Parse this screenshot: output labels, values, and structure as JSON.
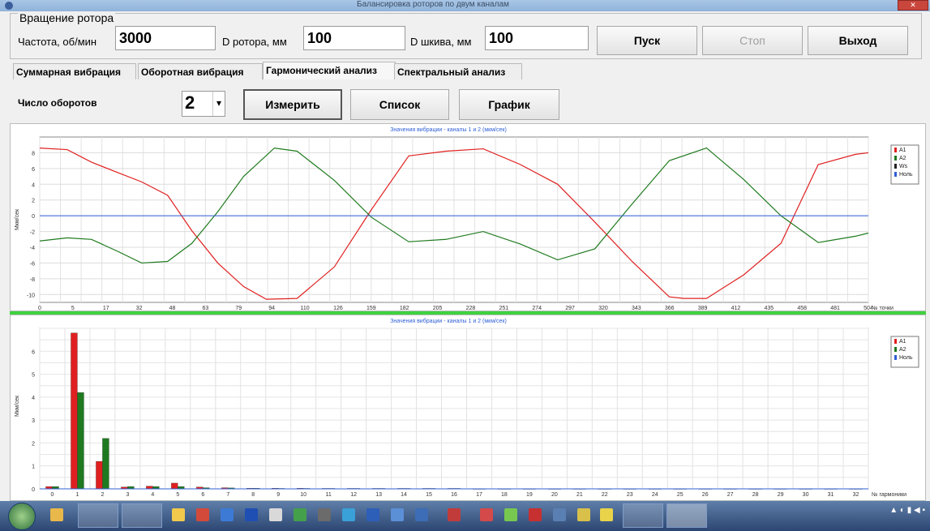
{
  "window": {
    "title": "Балансировка роторов по двум каналам"
  },
  "rotation_group": {
    "title": "Вращение ротора",
    "freq_label": "Частота, об/мин",
    "freq_value": "3000",
    "rotor_d_label": "D ротора, мм",
    "rotor_d_value": "100",
    "pulley_d_label": "D шкива, мм",
    "pulley_d_value": "100"
  },
  "buttons": {
    "start": "Пуск",
    "stop": "Стоп",
    "exit": "Выход",
    "measure": "Измерить",
    "list": "Список",
    "graph": "График"
  },
  "tabs": [
    "Суммарная вибрация",
    "Оборотная вибрация",
    "Гармонический анализ",
    "Спектральный анализ"
  ],
  "active_tab": 2,
  "revolutions": {
    "label": "Число оборотов",
    "value": "2"
  },
  "colors": {
    "a1": "#e02020",
    "a2": "#1f7a1f",
    "zero": "#2f5fd6",
    "accent_sep": "#3fd23f"
  },
  "chart_data": [
    {
      "type": "line",
      "title": "Значения вибрации - каналы 1 и 2 (мкм/сек)",
      "ylabel": "Мкм/сек",
      "xlabel": "№ точки",
      "ylim": [
        -11,
        10
      ],
      "yticks": [
        8,
        6,
        4,
        2,
        0,
        -2,
        -4,
        -6,
        -8,
        -10
      ],
      "xticks": [
        "0",
        "5",
        "17",
        "32",
        "48",
        "63",
        "79",
        "94",
        "110",
        "126",
        "159",
        "182",
        "205",
        "228",
        "251",
        "274",
        "297",
        "320",
        "343",
        "366",
        "389",
        "412",
        "435",
        "458",
        "481",
        "504"
      ],
      "xrange": [
        0,
        512
      ],
      "legend": [
        "A1",
        "A2",
        "Ws",
        "Ноль"
      ],
      "legend_position": "right",
      "grid": true,
      "series": [
        {
          "name": "A1",
          "x": [
            0,
            17,
            32,
            48,
            63,
            79,
            94,
            110,
            126,
            140,
            159,
            182,
            205,
            228,
            251,
            274,
            297,
            320,
            343,
            366,
            389,
            398,
            412,
            435,
            458,
            481,
            504,
            512
          ],
          "y": [
            8.6,
            8.4,
            6.8,
            5.5,
            4.3,
            2.6,
            -1.9,
            -6,
            -9,
            -10.6,
            -10.5,
            -6.5,
            0.8,
            7.6,
            8.2,
            8.5,
            6.5,
            4,
            -0.8,
            -5.8,
            -10.3,
            -10.5,
            -10.5,
            -7.5,
            -3.5,
            6.5,
            7.8,
            8
          ]
        },
        {
          "name": "A2",
          "x": [
            0,
            17,
            32,
            48,
            63,
            79,
            94,
            110,
            126,
            145,
            159,
            182,
            205,
            228,
            251,
            274,
            297,
            320,
            343,
            366,
            389,
            412,
            435,
            458,
            481,
            504,
            512
          ],
          "y": [
            -3.2,
            -2.8,
            -3,
            -4.5,
            -6,
            -5.8,
            -3.5,
            0.5,
            5,
            8.6,
            8.2,
            4.5,
            -0.2,
            -3.3,
            -3,
            -2,
            -3.6,
            -5.6,
            -4.2,
            1.5,
            7,
            8.6,
            4.6,
            0,
            -3.4,
            -2.6,
            -2.2
          ]
        },
        {
          "name": "Ноль",
          "x": [
            0,
            512
          ],
          "y": [
            0,
            0
          ]
        }
      ]
    },
    {
      "type": "bar",
      "title": "Значения вибрации - каналы 1 и 2 (мкм/сек)",
      "ylabel": "Мкм/сек",
      "xlabel": "№ гармоники",
      "ylim": [
        0,
        7
      ],
      "yticks": [
        0,
        1,
        2,
        3,
        4,
        5,
        6
      ],
      "categories": [
        "0",
        "1",
        "2",
        "3",
        "4",
        "5",
        "6",
        "7",
        "8",
        "9",
        "10",
        "11",
        "12",
        "13",
        "14",
        "15",
        "16",
        "17",
        "18",
        "19",
        "20",
        "21",
        "22",
        "23",
        "24",
        "25",
        "26",
        "27",
        "28",
        "29",
        "30",
        "31",
        "32"
      ],
      "legend": [
        "A1",
        "A2",
        "Ноль"
      ],
      "legend_position": "right",
      "grid": true,
      "series": [
        {
          "name": "A1",
          "values": [
            0.1,
            6.8,
            1.2,
            0.08,
            0.12,
            0.25,
            0.08,
            0.05,
            0.03,
            0.03,
            0.03,
            0.02,
            0.02,
            0.02,
            0.02,
            0.02,
            0.02,
            0.01,
            0.01,
            0.01,
            0.01,
            0.01,
            0.01,
            0.01,
            0.01,
            0.01,
            0.01,
            0.01,
            0.01,
            0.01,
            0.01,
            0.01,
            0.01
          ]
        },
        {
          "name": "A2",
          "values": [
            0.1,
            4.2,
            2.2,
            0.1,
            0.1,
            0.1,
            0.05,
            0.04,
            0.03,
            0.02,
            0.02,
            0.02,
            0.02,
            0.02,
            0.02,
            0.02,
            0.02,
            0.01,
            0.01,
            0.01,
            0.01,
            0.01,
            0.01,
            0.01,
            0.01,
            0.01,
            0.01,
            0.01,
            0.01,
            0.01,
            0.01,
            0.01,
            0.01
          ]
        }
      ]
    }
  ]
}
